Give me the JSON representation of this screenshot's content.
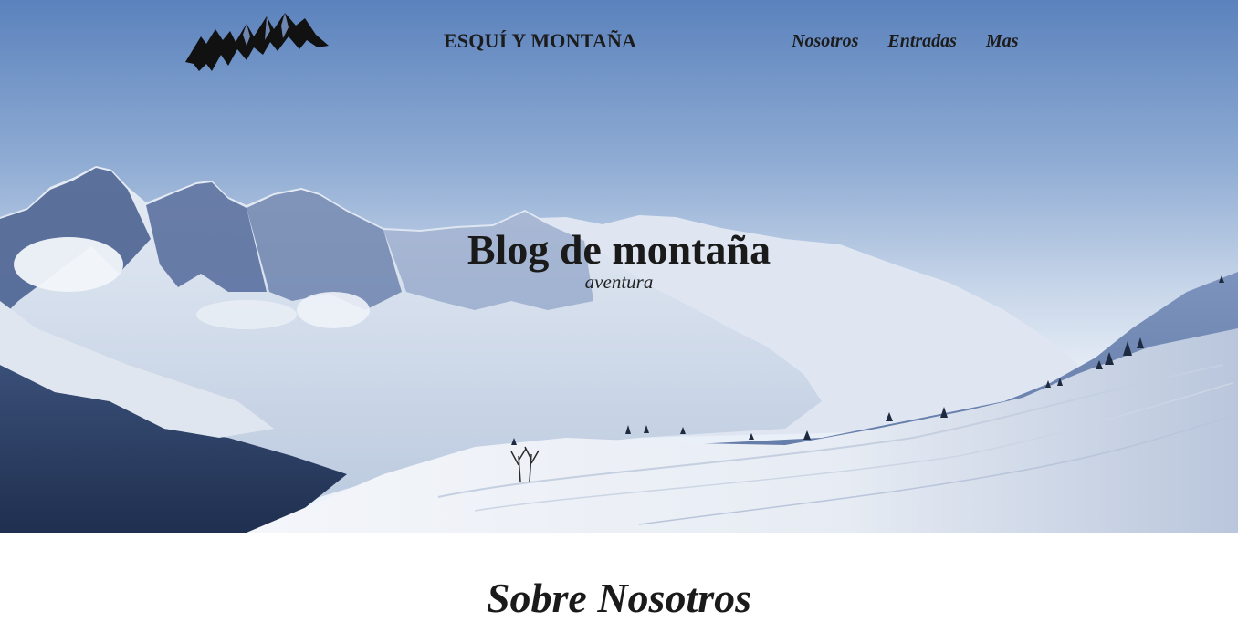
{
  "header": {
    "logo_icon": "mountain-logo-icon",
    "brand": "ESQUÍ Y MONTAÑA",
    "nav": [
      {
        "label": "Nosotros"
      },
      {
        "label": "Entradas"
      },
      {
        "label": "Mas"
      }
    ]
  },
  "hero": {
    "title": "Blog de montaña",
    "subtitle": "aventura",
    "image_icon": "snowy-mountains-photo"
  },
  "main": {
    "section_heading": "Sobre Nosotros"
  }
}
